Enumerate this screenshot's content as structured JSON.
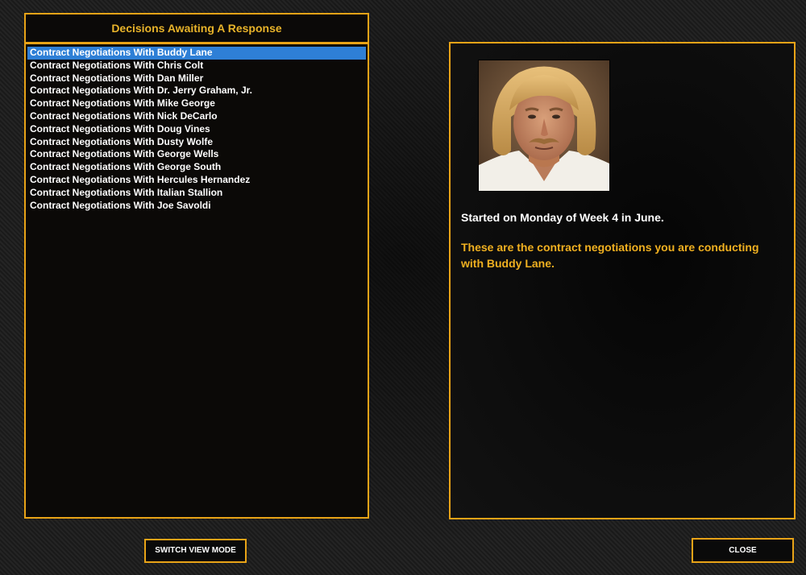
{
  "left_panel": {
    "header": "Decisions Awaiting A Response",
    "items": [
      {
        "label": "Contract Negotiations With Buddy Lane",
        "selected": true
      },
      {
        "label": "Contract Negotiations With Chris Colt",
        "selected": false
      },
      {
        "label": "Contract Negotiations With Dan Miller",
        "selected": false
      },
      {
        "label": "Contract Negotiations With Dr. Jerry Graham, Jr.",
        "selected": false
      },
      {
        "label": "Contract Negotiations With Mike George",
        "selected": false
      },
      {
        "label": "Contract Negotiations With Nick DeCarlo",
        "selected": false
      },
      {
        "label": "Contract Negotiations With Doug Vines",
        "selected": false
      },
      {
        "label": "Contract Negotiations With Dusty Wolfe",
        "selected": false
      },
      {
        "label": "Contract Negotiations With George Wells",
        "selected": false
      },
      {
        "label": "Contract Negotiations With George South",
        "selected": false
      },
      {
        "label": "Contract Negotiations With Hercules Hernandez",
        "selected": false
      },
      {
        "label": "Contract Negotiations With Italian Stallion",
        "selected": false
      },
      {
        "label": "Contract Negotiations With Joe Savoldi",
        "selected": false
      }
    ]
  },
  "detail": {
    "started_text": "Started on Monday of Week 4 in June.",
    "description": "These are the contract negotiations you are conducting with Buddy Lane."
  },
  "buttons": {
    "switch_view": "SWITCH VIEW MODE",
    "close": "CLOSE"
  },
  "colors": {
    "accent": "#e8a317",
    "selection": "#2e7fd6",
    "description_text": "#f0b020"
  }
}
